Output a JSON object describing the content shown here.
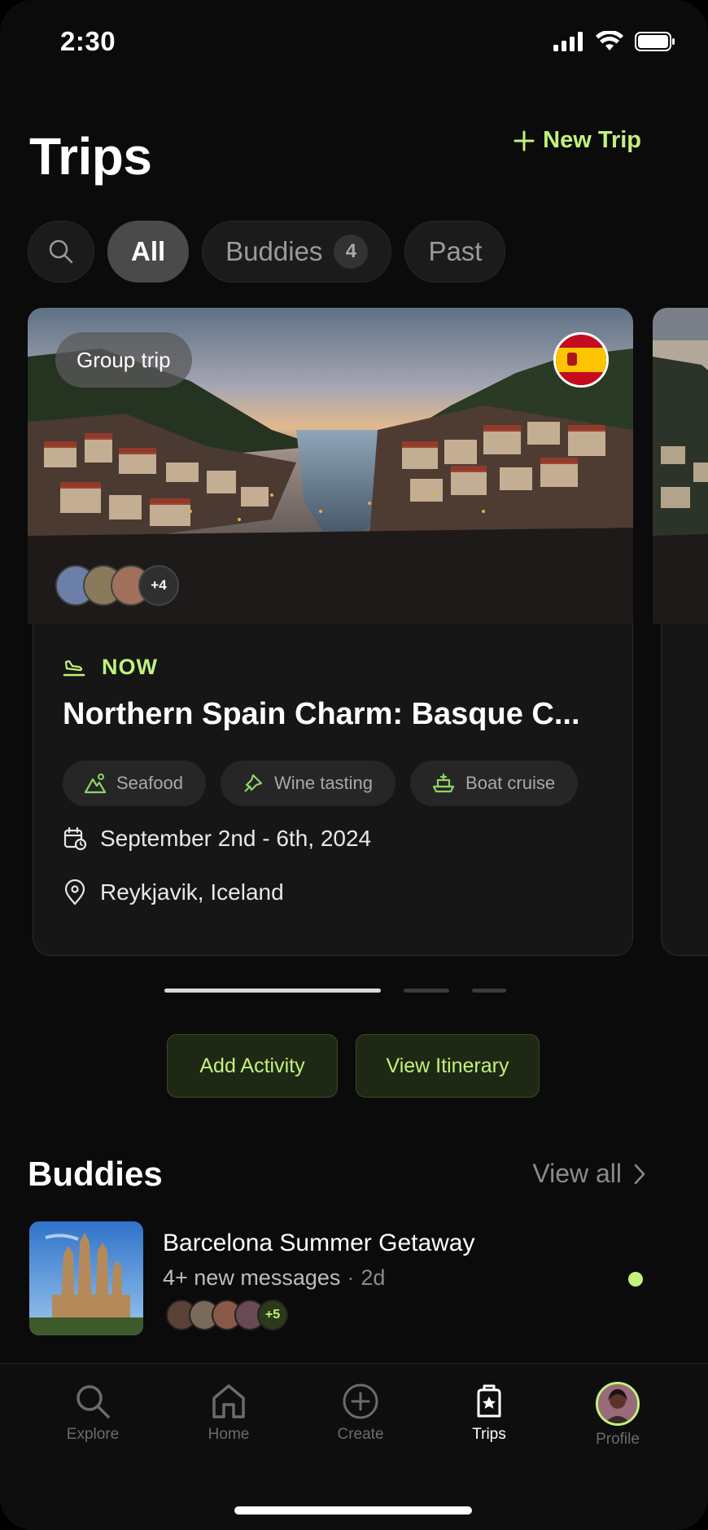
{
  "status": {
    "time": "2:30"
  },
  "header": {
    "title": "Trips",
    "new_trip_label": "New Trip"
  },
  "filters": {
    "items": [
      {
        "label": "All",
        "active": true
      },
      {
        "label": "Buddies",
        "count": "4",
        "active": false
      },
      {
        "label": "Past",
        "active": false
      }
    ]
  },
  "trip_card": {
    "badge": "Group trip",
    "flag": "spain-flag-icon",
    "avatars_more": "+4",
    "status": "NOW",
    "title": "Northern Spain Charm: Basque C...",
    "tags": [
      {
        "icon": "mountain-icon",
        "label": "Seafood"
      },
      {
        "icon": "airplane-icon",
        "label": "Wine tasting"
      },
      {
        "icon": "ship-icon",
        "label": "Boat cruise"
      }
    ],
    "dates": "September 2nd - 6th, 2024",
    "location": "Reykjavik, Iceland"
  },
  "actions": {
    "add_activity": "Add Activity",
    "view_itinerary": "View Itinerary"
  },
  "buddies": {
    "title": "Buddies",
    "view_all": "View all",
    "item": {
      "title": "Barcelona Summer Getaway",
      "messages": "4+ new messages",
      "ago": "2d",
      "avatars_more": "+5"
    }
  },
  "tabbar": {
    "items": [
      {
        "label": "Explore",
        "icon": "search-icon"
      },
      {
        "label": "Home",
        "icon": "home-icon"
      },
      {
        "label": "Create",
        "icon": "plus-circle-icon"
      },
      {
        "label": "Trips",
        "icon": "luggage-icon",
        "active": true
      },
      {
        "label": "Profile",
        "icon": "avatar"
      }
    ]
  },
  "colors": {
    "accent": "#c2f27a",
    "background": "#0b0b0b",
    "card": "#161616"
  }
}
